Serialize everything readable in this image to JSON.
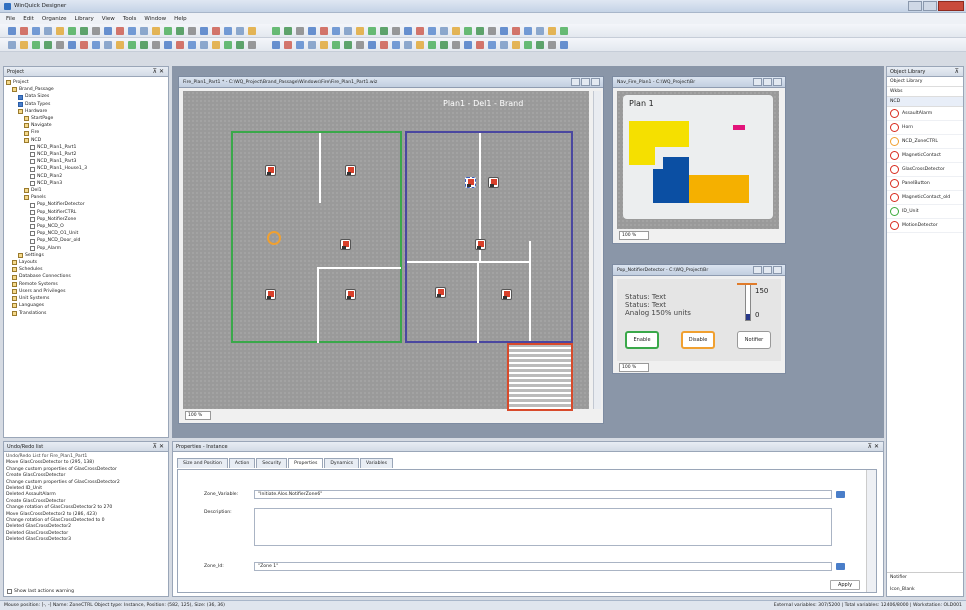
{
  "window": {
    "title": "WinQuick Designer"
  },
  "menu": [
    "File",
    "Edit",
    "Organize",
    "Library",
    "View",
    "Tools",
    "Window",
    "Help"
  ],
  "project_panel": {
    "title": "Project",
    "items": [
      "Project",
      "Brand_Passage",
      "Data Sizes",
      "Data Types",
      "Hardware",
      "StartPage",
      "Navigate",
      "Fire",
      "NCD",
      "NCD_Plan1_Part1",
      "NCD_Plan1_Part2",
      "NCD_Plan1_Part3",
      "NCD_Plan1_House1_3",
      "NCD_Plan2",
      "NCD_Plan3",
      "Del1",
      "Panels",
      "Pop_NotifierDetector",
      "Pop_NotifierCTRL",
      "Pop_NotifierZone",
      "Pop_NCD_O",
      "Pop_NCD_O1_Unit",
      "Pop_NCD_Door_old",
      "Pop_Alarm",
      "Settings",
      "Layouts",
      "Schedules",
      "Database Connections",
      "Remote Systems",
      "Users and Privileges",
      "Unit Systems",
      "Languages",
      "Translations"
    ]
  },
  "undo_panel": {
    "title": "Undo/Redo list",
    "items": [
      "Undo/Redo List for Fire_Plan1_Part1",
      "Move GlasCrossDetector to (295, 138)",
      "Change custom properties of GlasCrossDetector",
      "Create GlasCrossDetector",
      "Change custom properties of GlasCrossDetector2",
      "Deleted ID_Unit",
      "Deleted AssaultAlarm",
      "Create GlasCrossDetector",
      "Change rotation of GlasCrossDetector2 to 270",
      "Move GlasCrossDetector2 to (286, 423)",
      "Change rotation of GlasCrossDetected to 0",
      "Deleted GlasCrossDetector2",
      "Deleted GlasCrossDetector",
      "Deleted GlasCrossDetector3"
    ],
    "checkbox_label": "Show last actions warning"
  },
  "main_doc": {
    "title": "Fire_Plan1_Part1 * - C:\\WQ_Project\\Brand_Passage\\Windows\\Fire\\Fire_Plan1_Part1.wiz",
    "plan_label": "Plan1 - Del1 - Brand",
    "zoom": "100 %"
  },
  "overview_doc": {
    "title": "Nav_Fire_Plan1 - C:\\WQ_Project\\Br",
    "plan_label": "Plan 1",
    "zoom": "100 %",
    "colors": {
      "yellow": "#f5e000",
      "blue": "#0b4fa3",
      "orange": "#f5b000",
      "pink": "#e2137a"
    }
  },
  "popup_doc": {
    "title": "Pop_NotifierDetector - C:\\WQ_Project\\Br",
    "status_lines": [
      "Status: Text",
      "Status: Text",
      "Analog 150% units"
    ],
    "gauge_top": "150",
    "gauge_bottom": "0",
    "buttons": [
      "Enable",
      "Disable",
      "Notifier"
    ],
    "zoom": "100 %"
  },
  "properties": {
    "title": "Properties - Instance",
    "tabs": [
      "Size and Position",
      "Action",
      "Security",
      "Properties",
      "Dynamics",
      "Variables"
    ],
    "active_tab": "Properties",
    "zone_label": "Zone_Variable:",
    "zone_value": "\"Initiate.Alos.NotifierZone6\"",
    "description_label": "Description:",
    "zone_name_label": "Zone_Id:",
    "zone_name_value": "\"Zone 1\"",
    "apply_label": "Apply"
  },
  "object_library": {
    "title": "Object Library",
    "header": "Object Library",
    "sub1": "Wkbs",
    "sub2": "NCD",
    "items": [
      {
        "label": "AssaultAlarm",
        "color": "#d82b1f"
      },
      {
        "label": "Horn",
        "color": "#d82b1f"
      },
      {
        "label": "NCD_ZoneCTRL",
        "color": "#f0a030"
      },
      {
        "label": "MagneticContact",
        "color": "#d82b1f"
      },
      {
        "label": "GlasCrossDetector",
        "color": "#d82b1f"
      },
      {
        "label": "PanelButton",
        "color": "#d82b1f"
      },
      {
        "label": "MagneticContact_old",
        "color": "#d82b1f"
      },
      {
        "label": "ID_Unit",
        "color": "#3caa3c"
      },
      {
        "label": "MotionDetector",
        "color": "#d82b1f"
      }
    ],
    "footer1": "Notifier",
    "footer2": "Icon_Blank"
  },
  "status": {
    "left": "Mouse position: [-, -]   Name: ZoneCTRL  Object type: Instance,  Position: (582, 125), Size: (36, 36)",
    "right": "External variables: 307/5200 | Total variables: 12406/8000 | Workstation: OLD001"
  }
}
